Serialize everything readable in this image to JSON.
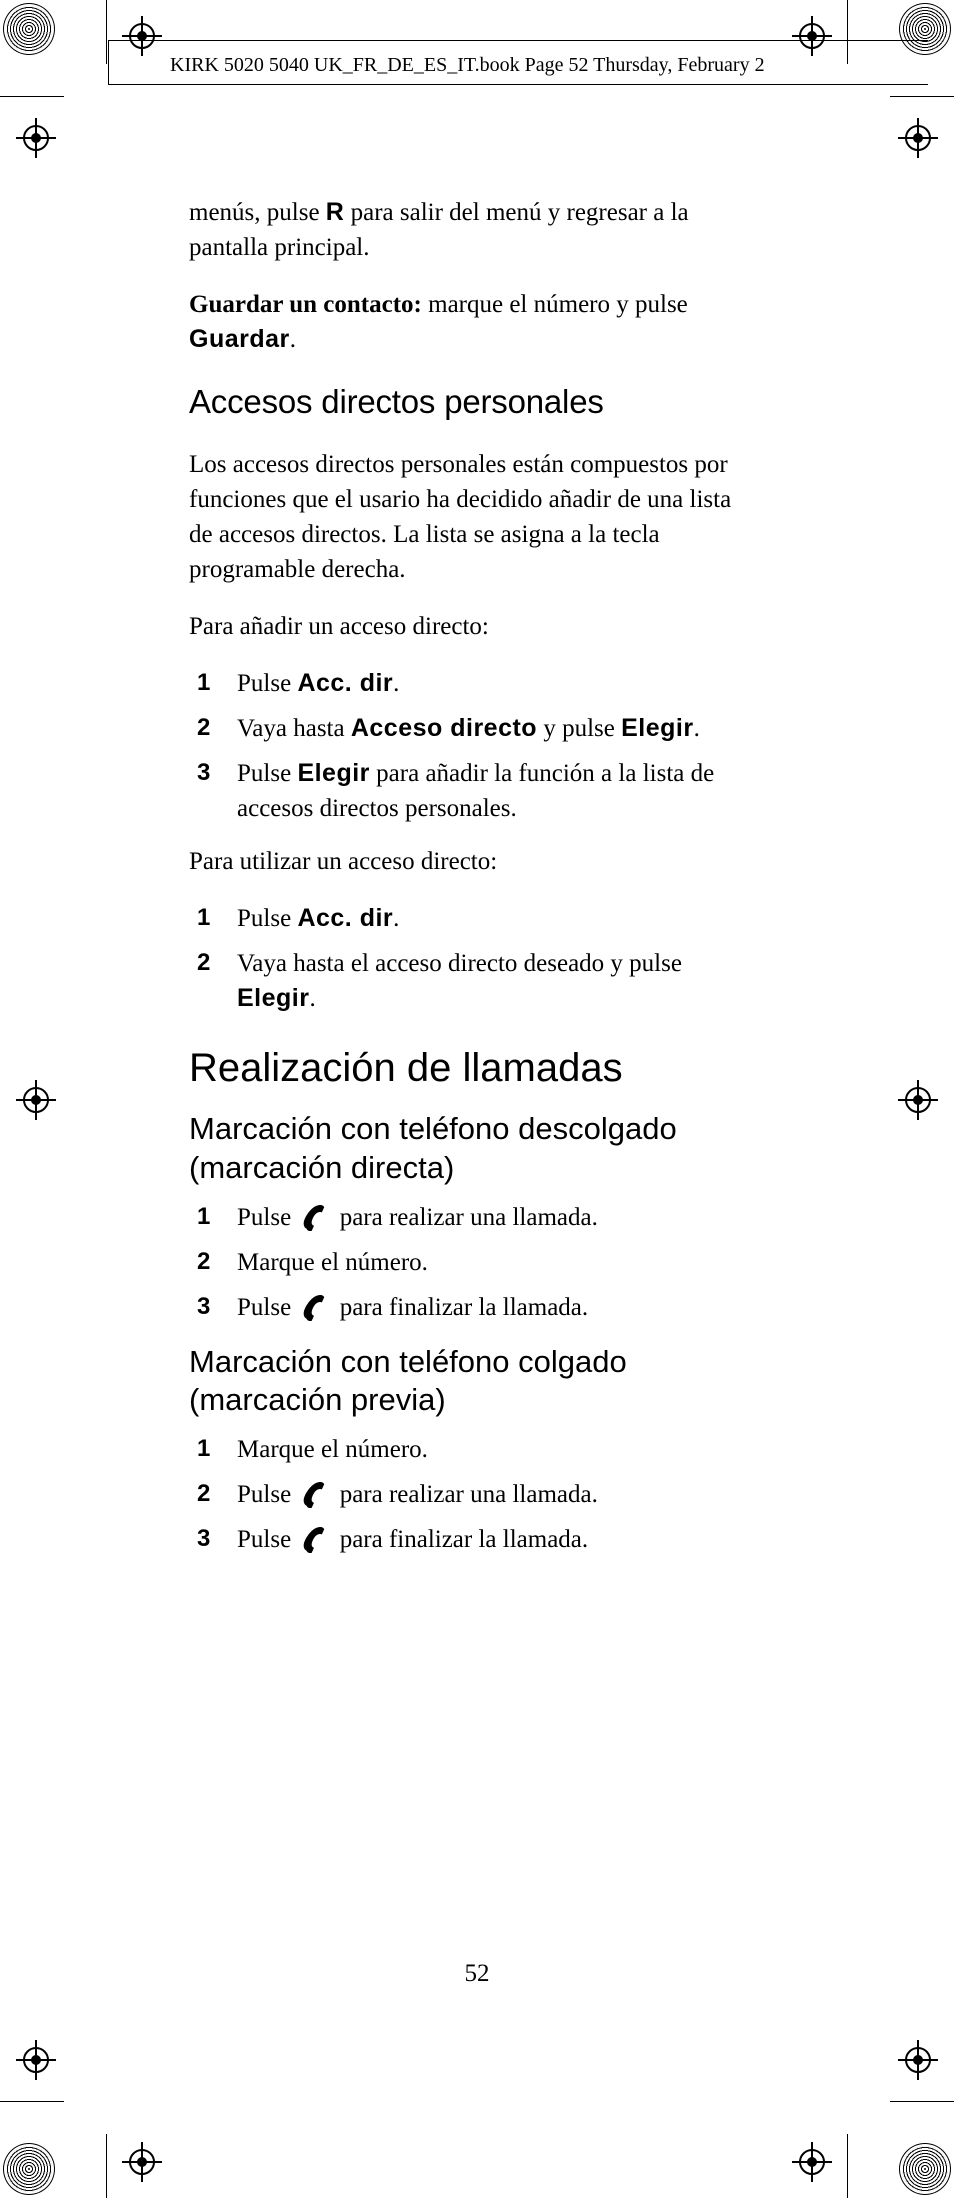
{
  "header": "KIRK 5020 5040 UK_FR_DE_ES_IT.book  Page 52  Thursday, February 2",
  "intro_p1_a": "menús, pulse ",
  "intro_p1_key": "R",
  "intro_p1_b": " para salir del menú y regresar a la pantalla principal.",
  "save_contact_label": "Guardar un contacto:",
  "save_contact_a": " marque el número y pulse ",
  "save_contact_key": "Guardar",
  "save_contact_b": ".",
  "h_accesos": "Accesos directos personales",
  "accesos_p": "Los accesos directos personales están compuestos por funciones que el usario ha decidido añadir de una lista de accesos directos. La lista se asigna a la tecla programable derecha.",
  "accesos_add_intro": "Para añadir un acceso directo:",
  "add_step1_a": "Pulse ",
  "add_step1_key": "Acc. dir",
  "add_step1_b": ".",
  "add_step2_a": "Vaya hasta ",
  "add_step2_key1": "Acceso directo",
  "add_step2_b": " y pulse ",
  "add_step2_key2": "Elegir",
  "add_step2_c": ".",
  "add_step3_a": "Pulse ",
  "add_step3_key": "Elegir",
  "add_step3_b": " para añadir la función a la lista de accesos directos personales.",
  "accesos_use_intro": "Para utilizar un acceso directo:",
  "use_step1_a": "Pulse ",
  "use_step1_key": "Acc. dir",
  "use_step1_b": ".",
  "use_step2_a": "Vaya hasta el acceso directo deseado y pulse ",
  "use_step2_key": "Elegir",
  "use_step2_b": ".",
  "h_realizacion": "Realización de llamadas",
  "h_descolgado": "Marcación con teléfono descolgado (marcación directa)",
  "desc_step1_a": "Pulse ",
  "desc_step1_b": " para realizar una llamada.",
  "desc_step2": "Marque el número.",
  "desc_step3_a": "Pulse ",
  "desc_step3_b": " para finalizar la llamada.",
  "h_colgado": "Marcación con teléfono colgado (marcación previa)",
  "col_step1": "Marque el número.",
  "col_step2_a": "Pulse ",
  "col_step2_b": " para realizar una llamada.",
  "col_step3_a": "Pulse ",
  "col_step3_b": " para finalizar la llamada.",
  "page_number": "52"
}
